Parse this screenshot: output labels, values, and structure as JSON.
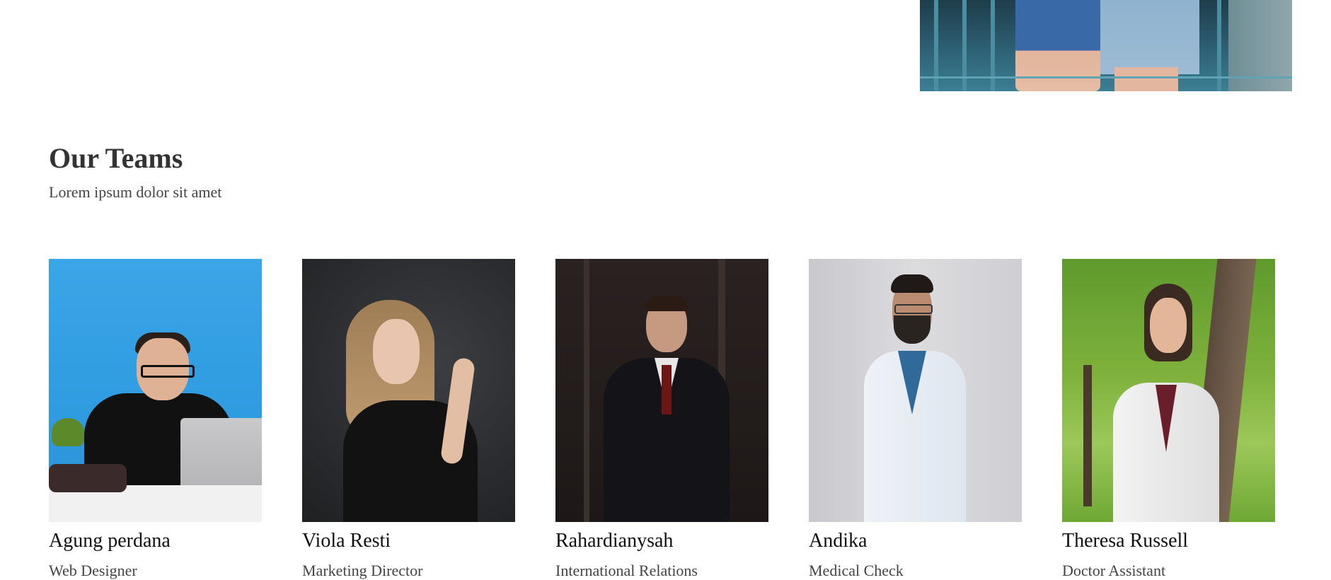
{
  "section": {
    "title": "Our Teams",
    "subtitle": "Lorem ipsum dolor sit amet"
  },
  "team": [
    {
      "name": "Agung perdana",
      "role": "Web Designer"
    },
    {
      "name": "Viola Resti",
      "role": "Marketing Director"
    },
    {
      "name": "Rahardianysah",
      "role": "International Relations"
    },
    {
      "name": "Andika",
      "role": "Medical Check"
    },
    {
      "name": "Theresa Russell",
      "role": "Doctor Assistant"
    }
  ]
}
